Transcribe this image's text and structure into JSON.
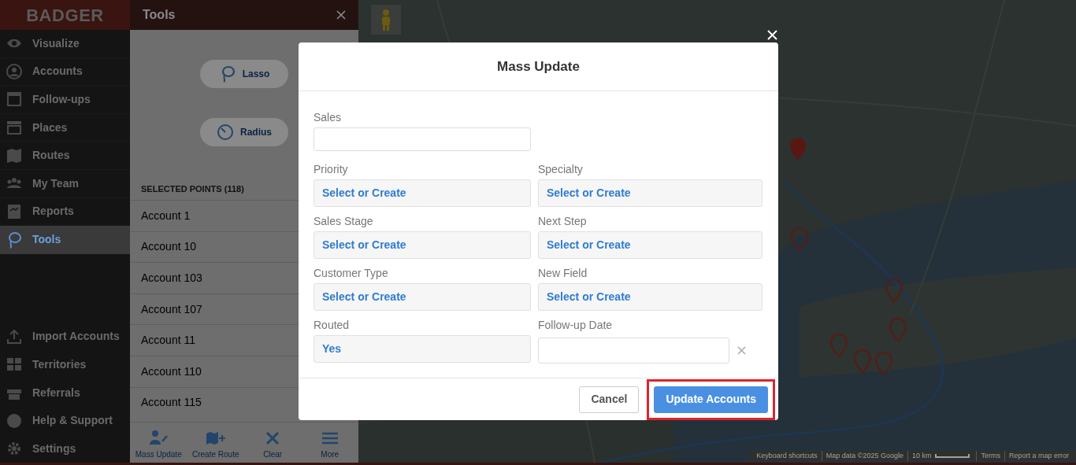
{
  "sidebar": {
    "logo": "BADGER",
    "items": [
      {
        "label": "Visualize",
        "selected": false
      },
      {
        "label": "Accounts",
        "selected": false
      },
      {
        "label": "Follow-ups",
        "selected": false
      },
      {
        "label": "Places",
        "selected": false
      },
      {
        "label": "Routes",
        "selected": false
      },
      {
        "label": "My Team",
        "selected": false
      },
      {
        "label": "Reports",
        "selected": false
      },
      {
        "label": "Tools",
        "selected": true
      }
    ],
    "bottom_items": [
      {
        "label": "Import Accounts"
      },
      {
        "label": "Territories"
      },
      {
        "label": "Referrals"
      },
      {
        "label": "Help & Support"
      },
      {
        "label": "Settings"
      }
    ]
  },
  "tools_panel": {
    "title": "Tools",
    "tools": [
      {
        "label": "Lasso"
      },
      {
        "label": "Radius"
      }
    ],
    "selected_header": "SELECTED POINTS (118)",
    "accounts": [
      "Account 1",
      "Account 10",
      "Account 103",
      "Account 107",
      "Account 11",
      "Account 110",
      "Account 115"
    ],
    "toolbar": [
      {
        "label": "Mass Update"
      },
      {
        "label": "Create Route"
      },
      {
        "label": "Clear"
      },
      {
        "label": "More"
      }
    ]
  },
  "map": {
    "attribution": [
      "Keyboard shortcuts",
      "Map data ©2025 Google",
      "10 km",
      "Terms",
      "Report a map error"
    ]
  },
  "modal": {
    "title": "Mass Update",
    "fields": [
      {
        "label": "Sales",
        "kind": "text"
      },
      {
        "label": "Priority",
        "kind": "select",
        "value": "Select or Create"
      },
      {
        "label": "Specialty",
        "kind": "select",
        "value": "Select or Create"
      },
      {
        "label": "Sales Stage",
        "kind": "select",
        "value": "Select or Create"
      },
      {
        "label": "Next Step",
        "kind": "select",
        "value": "Select or Create"
      },
      {
        "label": "Customer Type",
        "kind": "select",
        "value": "Select or Create"
      },
      {
        "label": "New Field",
        "kind": "select",
        "value": "Select or Create"
      },
      {
        "label": "Routed",
        "kind": "select",
        "value": "Yes"
      },
      {
        "label": "Follow-up Date",
        "kind": "date"
      }
    ],
    "buttons": [
      {
        "label": "Cancel",
        "kind": "secondary",
        "highlighted": false
      },
      {
        "label": "Update Accounts",
        "kind": "primary",
        "highlighted": true
      }
    ]
  }
}
